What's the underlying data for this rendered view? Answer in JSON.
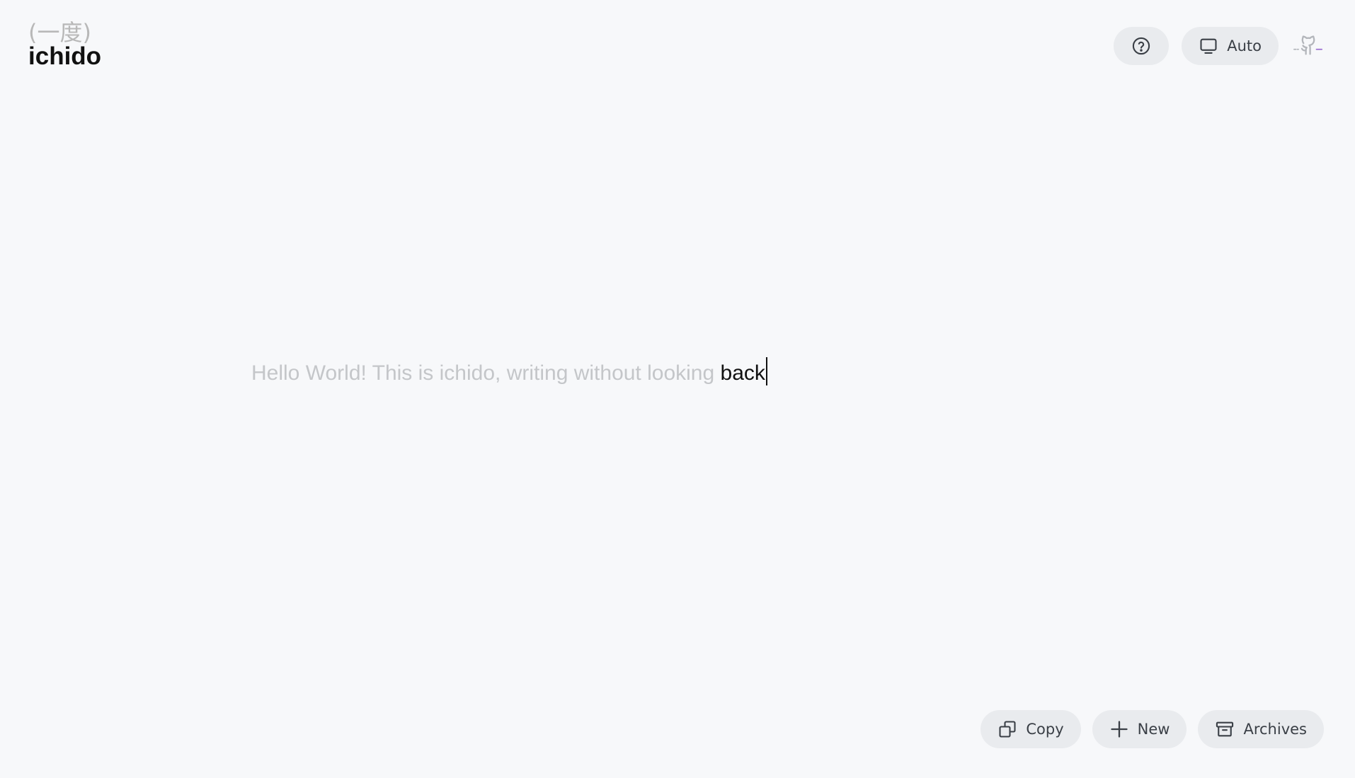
{
  "logo": {
    "kanji": "(一度)",
    "name": "ichido"
  },
  "header": {
    "help_icon": "help-circle-icon",
    "theme_icon": "monitor-icon",
    "theme_label": "Auto",
    "github_icon": "github-octocat-icon"
  },
  "editor": {
    "faded_text": "Hello World! This is ichido, writing without looking",
    "current_word": "back"
  },
  "toolbar": {
    "copy_label": "Copy",
    "copy_icon": "copy-icon",
    "new_label": "New",
    "new_icon": "plus-icon",
    "archives_label": "Archives",
    "archives_icon": "archive-box-icon"
  },
  "colors": {
    "background": "#f7f8fa",
    "pill": "#e9ebee",
    "faded_text": "#c4c6c9",
    "text": "#111111",
    "github_accent": "#9b6fd0"
  }
}
